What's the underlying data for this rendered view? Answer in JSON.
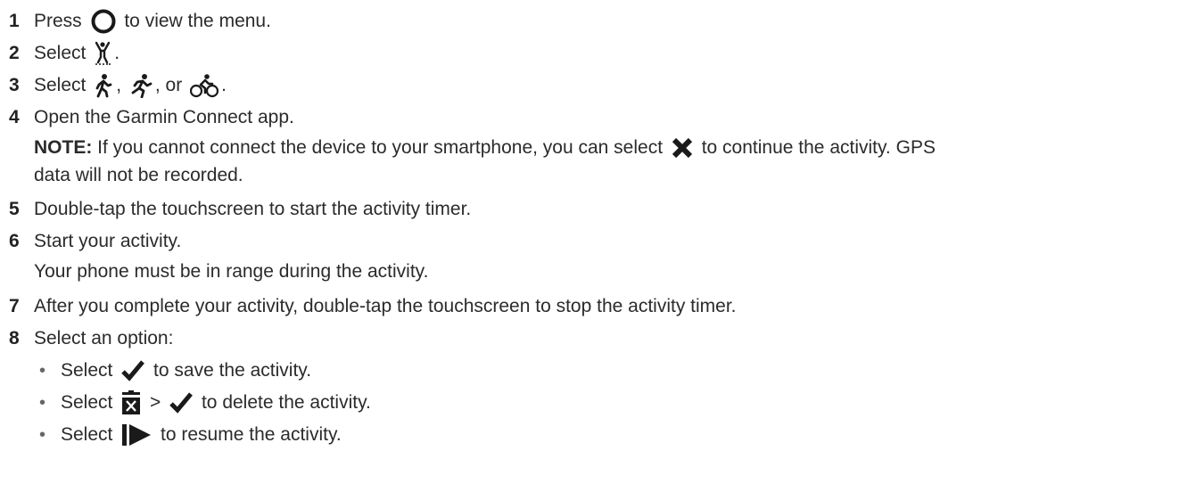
{
  "steps": [
    {
      "num": "1",
      "pre": "Press ",
      "post": " to view the menu."
    },
    {
      "num": "2",
      "pre": "Select ",
      "post": "."
    },
    {
      "num": "3",
      "pre": "Select ",
      "sep1": ", ",
      "sep2": ", or ",
      "post": "."
    },
    {
      "num": "4",
      "text": "Open the Garmin Connect app."
    },
    {
      "num": "5",
      "text": "Double-tap the touchscreen to start the activity timer."
    },
    {
      "num": "6",
      "text": "Start your activity."
    },
    {
      "num": "7",
      "text": "After you complete your activity, double-tap the touchscreen to stop the activity timer."
    },
    {
      "num": "8",
      "text": "Select an option:"
    }
  ],
  "note": {
    "label": "NOTE:",
    "pre": " If you cannot connect the device to your smartphone, you can select ",
    "post": " to continue the activity. GPS",
    "line2": "data will not be recorded."
  },
  "step6_continuation": "Your phone must be in range during the activity.",
  "options": [
    {
      "pre": "Select ",
      "post": " to save the activity."
    },
    {
      "pre": "Select ",
      "mid": " > ",
      "post": " to delete the activity."
    },
    {
      "pre": "Select ",
      "post": " to resume the activity."
    }
  ],
  "bullet_char": "•",
  "icons": {
    "menu": "circle-button-icon",
    "activity": "activity-icon",
    "walk": "walk-icon",
    "run": "run-icon",
    "bike": "bike-icon",
    "cancel": "x-icon",
    "save": "checkmark-icon",
    "discard": "discard-icon",
    "resume": "resume-icon"
  }
}
